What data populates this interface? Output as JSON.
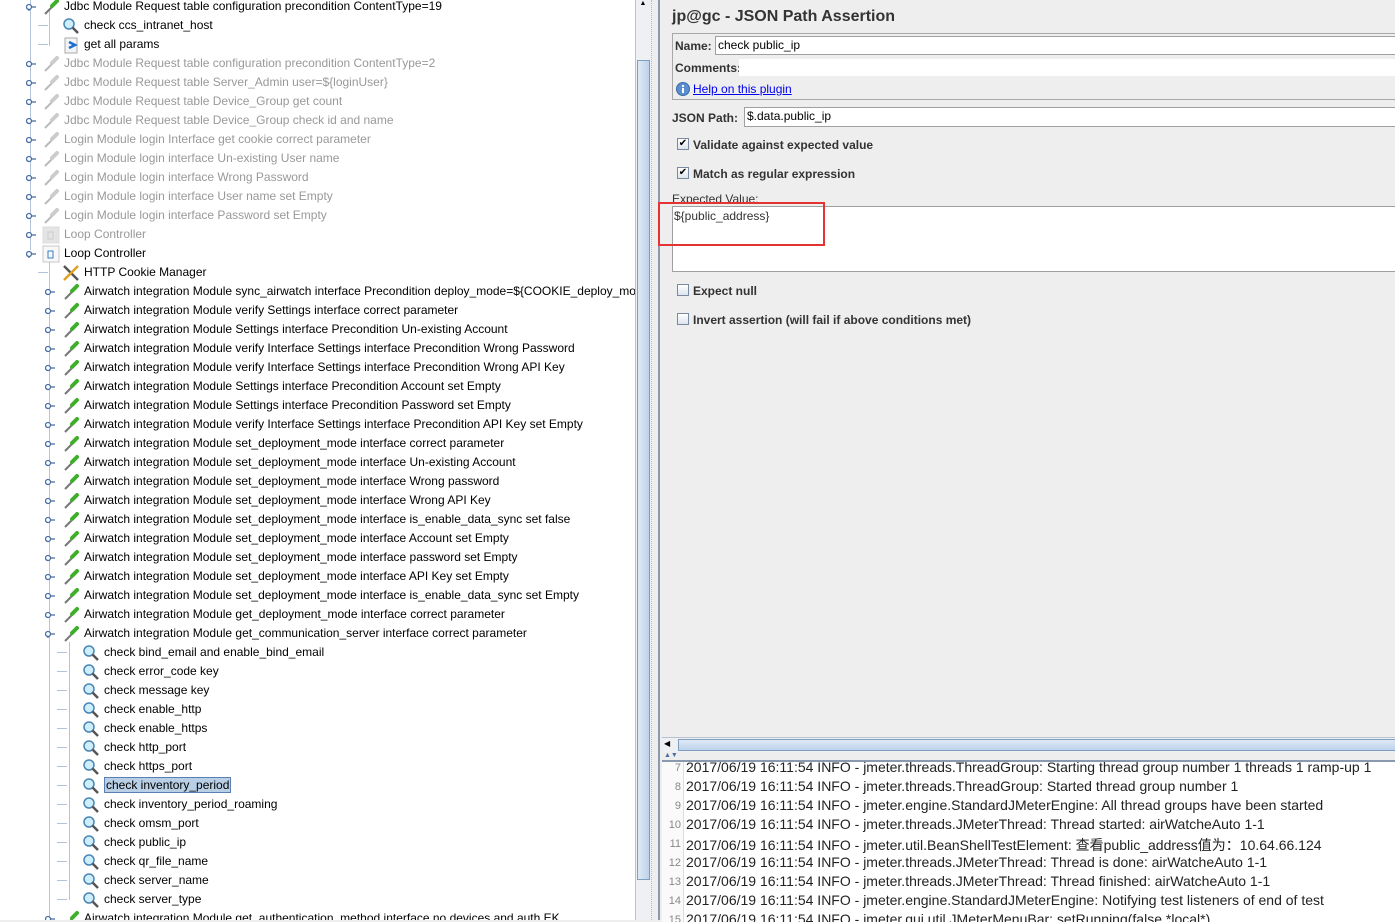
{
  "tree": {
    "selected_index": 41,
    "rows": [
      {
        "level": 1,
        "icon": "sampler-icon",
        "text": "Jdbc Module Request table configuration precondition ContentType=19",
        "disabled": false,
        "state": "open"
      },
      {
        "level": 2,
        "icon": "assertion-icon",
        "text": "check ccs_intranet_host",
        "disabled": false,
        "state": "leaf"
      },
      {
        "level": 2,
        "icon": "params-icon",
        "text": "get all params",
        "disabled": false,
        "state": "leaf"
      },
      {
        "level": 1,
        "icon": "sampler-icon",
        "text": "Jdbc Module Request table configuration  precondition ContentType=2",
        "disabled": true,
        "state": "closed"
      },
      {
        "level": 1,
        "icon": "sampler-icon",
        "text": "Jdbc Module Request table Server_Admin user=${loginUser}",
        "disabled": true,
        "state": "closed"
      },
      {
        "level": 1,
        "icon": "sampler-icon",
        "text": "Jdbc Module Request table Device_Group  get count",
        "disabled": true,
        "state": "closed"
      },
      {
        "level": 1,
        "icon": "sampler-icon",
        "text": "Jdbc Module Request table Device_Group  check id and name",
        "disabled": true,
        "state": "closed"
      },
      {
        "level": 1,
        "icon": "sampler-icon",
        "text": "Login Module login Interface get cookie correct parameter",
        "disabled": true,
        "state": "closed"
      },
      {
        "level": 1,
        "icon": "sampler-icon",
        "text": "Login Module login interface Un-existing User name",
        "disabled": true,
        "state": "closed"
      },
      {
        "level": 1,
        "icon": "sampler-icon",
        "text": "Login Module login interface Wrong Password",
        "disabled": true,
        "state": "closed"
      },
      {
        "level": 1,
        "icon": "sampler-icon",
        "text": "Login Module login interface  User name set Empty",
        "disabled": true,
        "state": "closed"
      },
      {
        "level": 1,
        "icon": "sampler-icon",
        "text": "Login Module login interface Password set  Empty",
        "disabled": true,
        "state": "closed"
      },
      {
        "level": 1,
        "icon": "loop-controller-icon",
        "text": "Loop Controller",
        "disabled": true,
        "state": "closed"
      },
      {
        "level": 1,
        "icon": "loop-controller-icon",
        "text": "Loop Controller",
        "disabled": false,
        "state": "open"
      },
      {
        "level": 2,
        "icon": "cookie-manager-icon",
        "text": "HTTP Cookie Manager",
        "disabled": false,
        "state": "leaf"
      },
      {
        "level": 2,
        "icon": "sampler-icon",
        "text": "Airwatch integration Module sync_airwatch interface Precondition deploy_mode=${COOKIE_deploy_mode}",
        "disabled": false,
        "state": "closed"
      },
      {
        "level": 2,
        "icon": "sampler-icon",
        "text": "Airwatch integration Module verify Settings interface correct parameter",
        "disabled": false,
        "state": "closed"
      },
      {
        "level": 2,
        "icon": "sampler-icon",
        "text": "Airwatch integration Module Settings interface Precondition Un-existing Account",
        "disabled": false,
        "state": "closed"
      },
      {
        "level": 2,
        "icon": "sampler-icon",
        "text": "Airwatch integration Module verify Interface  Settings interface Precondition Wrong Password",
        "disabled": false,
        "state": "closed"
      },
      {
        "level": 2,
        "icon": "sampler-icon",
        "text": "Airwatch integration Module verify Interface  Settings interface Precondition Wrong API Key",
        "disabled": false,
        "state": "closed"
      },
      {
        "level": 2,
        "icon": "sampler-icon",
        "text": "Airwatch integration Module Settings interface Precondition Account set  Empty",
        "disabled": false,
        "state": "closed"
      },
      {
        "level": 2,
        "icon": "sampler-icon",
        "text": "Airwatch integration Module Settings interface Precondition Password set  Empty",
        "disabled": false,
        "state": "closed"
      },
      {
        "level": 2,
        "icon": "sampler-icon",
        "text": "Airwatch integration Module verify Interface Settings interface Precondition API Key  set  Empty",
        "disabled": false,
        "state": "closed"
      },
      {
        "level": 2,
        "icon": "sampler-icon",
        "text": "Airwatch integration Module set_deployment_mode interface correct parameter",
        "disabled": false,
        "state": "closed"
      },
      {
        "level": 2,
        "icon": "sampler-icon",
        "text": "Airwatch integration Module set_deployment_mode interface Un-existing Account",
        "disabled": false,
        "state": "closed"
      },
      {
        "level": 2,
        "icon": "sampler-icon",
        "text": "Airwatch integration Module set_deployment_mode interface Wrong password",
        "disabled": false,
        "state": "closed"
      },
      {
        "level": 2,
        "icon": "sampler-icon",
        "text": "Airwatch integration Module set_deployment_mode interface Wrong API Key",
        "disabled": false,
        "state": "closed"
      },
      {
        "level": 2,
        "icon": "sampler-icon",
        "text": "Airwatch integration Module set_deployment_mode interface is_enable_data_sync set  false",
        "disabled": false,
        "state": "closed"
      },
      {
        "level": 2,
        "icon": "sampler-icon",
        "text": "Airwatch integration Module set_deployment_mode interface  Account set  Empty",
        "disabled": false,
        "state": "closed"
      },
      {
        "level": 2,
        "icon": "sampler-icon",
        "text": "Airwatch integration Module set_deployment_mode interface  password set  Empty",
        "disabled": false,
        "state": "closed"
      },
      {
        "level": 2,
        "icon": "sampler-icon",
        "text": "Airwatch integration Module set_deployment_mode interface  API Key  set  Empty",
        "disabled": false,
        "state": "closed"
      },
      {
        "level": 2,
        "icon": "sampler-icon",
        "text": "Airwatch integration Module set_deployment_mode interface  is_enable_data_sync set  Empty",
        "disabled": false,
        "state": "closed"
      },
      {
        "level": 2,
        "icon": "sampler-icon",
        "text": "Airwatch integration Module get_deployment_mode interface correct parameter",
        "disabled": false,
        "state": "closed"
      },
      {
        "level": 2,
        "icon": "sampler-icon",
        "text": "Airwatch integration Module get_communication_server interface correct parameter",
        "disabled": false,
        "state": "open"
      },
      {
        "level": 3,
        "icon": "assertion-icon",
        "text": "check bind_email and enable_bind_email",
        "disabled": false,
        "state": "leaf"
      },
      {
        "level": 3,
        "icon": "assertion-icon",
        "text": "check error_code key",
        "disabled": false,
        "state": "leaf"
      },
      {
        "level": 3,
        "icon": "assertion-icon",
        "text": "check message key",
        "disabled": false,
        "state": "leaf"
      },
      {
        "level": 3,
        "icon": "assertion-icon",
        "text": "check enable_http",
        "disabled": false,
        "state": "leaf"
      },
      {
        "level": 3,
        "icon": "assertion-icon",
        "text": "check enable_https",
        "disabled": false,
        "state": "leaf"
      },
      {
        "level": 3,
        "icon": "assertion-icon",
        "text": "check http_port",
        "disabled": false,
        "state": "leaf"
      },
      {
        "level": 3,
        "icon": "assertion-icon",
        "text": "check https_port",
        "disabled": false,
        "state": "leaf"
      },
      {
        "level": 3,
        "icon": "assertion-icon",
        "text": "check inventory_period",
        "disabled": false,
        "state": "leaf"
      },
      {
        "level": 3,
        "icon": "assertion-icon",
        "text": "check inventory_period_roaming",
        "disabled": false,
        "state": "leaf"
      },
      {
        "level": 3,
        "icon": "assertion-icon",
        "text": "check omsm_port",
        "disabled": false,
        "state": "leaf"
      },
      {
        "level": 3,
        "icon": "assertion-icon",
        "text": "check public_ip",
        "disabled": false,
        "state": "leaf"
      },
      {
        "level": 3,
        "icon": "assertion-icon",
        "text": "check qr_file_name",
        "disabled": false,
        "state": "leaf"
      },
      {
        "level": 3,
        "icon": "assertion-icon",
        "text": "check server_name",
        "disabled": false,
        "state": "leaf"
      },
      {
        "level": 3,
        "icon": "assertion-icon",
        "text": "check server_type",
        "disabled": false,
        "state": "leaf"
      },
      {
        "level": 2,
        "icon": "sampler-icon",
        "text": "Airwatch integration Module get_authentication_method interface no devices and auth EK",
        "disabled": false,
        "state": "closed"
      }
    ]
  },
  "editor": {
    "title": "jp@gc - JSON Path Assertion",
    "name_label": "Name:",
    "name_value": "check public_ip",
    "comments_label": "Comments:",
    "help_link": "Help on this plugin",
    "json_path_label": "JSON Path:",
    "json_path_value": "$.data.public_ip",
    "validate_label": "Validate against expected value",
    "validate_checked": true,
    "regex_label": "Match as regular expression",
    "regex_checked": true,
    "expected_label": "Expected Value:",
    "expected_value": "${public_address}",
    "expect_null_label": "Expect null",
    "expect_null_checked": false,
    "invert_label": "Invert assertion (will fail if above conditions met)",
    "invert_checked": false
  },
  "log": {
    "lines": [
      {
        "n": "7",
        "text": "2017/06/19 16:11:54 INFO  - jmeter.threads.ThreadGroup: Starting thread group number 1 threads 1 ramp-up 1"
      },
      {
        "n": "8",
        "text": "2017/06/19 16:11:54 INFO  - jmeter.threads.ThreadGroup: Started thread group number 1"
      },
      {
        "n": "9",
        "text": "2017/06/19 16:11:54 INFO  - jmeter.engine.StandardJMeterEngine: All thread groups have been started"
      },
      {
        "n": "10",
        "text": "2017/06/19 16:11:54 INFO  - jmeter.threads.JMeterThread: Thread started: airWatcheAuto 1-1"
      },
      {
        "n": "11",
        "text": "2017/06/19 16:11:54 INFO  - jmeter.util.BeanShellTestElement: 查看public_address值为：10.64.66.124"
      },
      {
        "n": "12",
        "text": "2017/06/19 16:11:54 INFO  - jmeter.threads.JMeterThread: Thread is done: airWatcheAuto 1-1"
      },
      {
        "n": "13",
        "text": "2017/06/19 16:11:54 INFO  - jmeter.threads.JMeterThread: Thread finished: airWatcheAuto 1-1"
      },
      {
        "n": "14",
        "text": "2017/06/19 16:11:54 INFO  - jmeter.engine.StandardJMeterEngine: Notifying test listeners of end of test"
      },
      {
        "n": "15",
        "text": "2017/06/19 16:11:54 INFO  - jmeter.gui.util.JMeterMenuBar: setRunning(false,*local*)"
      }
    ]
  }
}
